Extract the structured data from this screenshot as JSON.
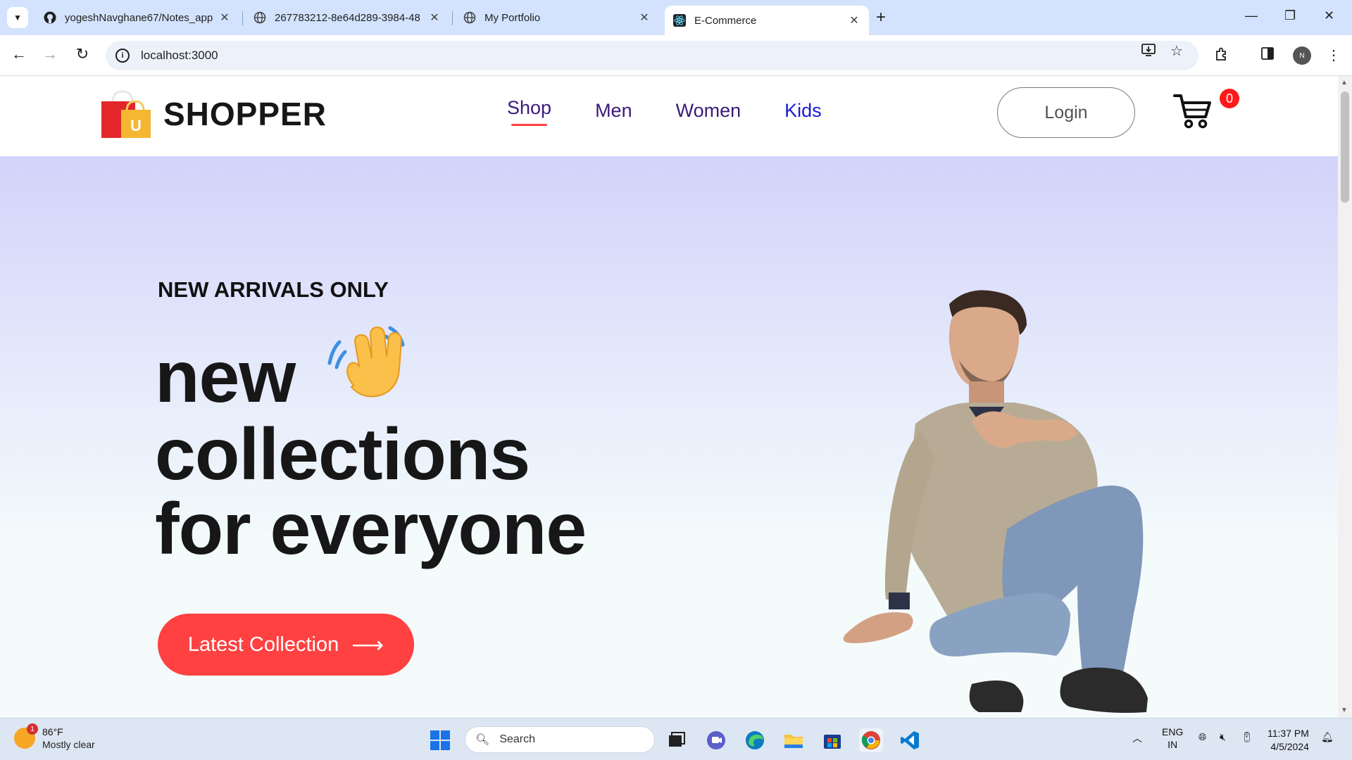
{
  "browser": {
    "tabs": [
      {
        "title": "yogeshNavghane67/Notes_app",
        "icon": "github-icon"
      },
      {
        "title": "267783212-8e64d289-3984-48",
        "icon": "globe-icon"
      },
      {
        "title": "My Portfolio",
        "icon": "globe-icon"
      },
      {
        "title": "E-Commerce",
        "icon": "react-icon",
        "active": true
      }
    ],
    "url": "localhost:3000"
  },
  "shop": {
    "brand": "SHOPPER",
    "logo_letter": "U",
    "menu": {
      "shop": "Shop",
      "men": "Men",
      "women": "Women",
      "kids": "Kids"
    },
    "login_label": "Login",
    "cart_count": "0"
  },
  "hero": {
    "kicker": "NEW ARRIVALS ONLY",
    "line1": "new",
    "line2": "collections",
    "line3": "for everyone",
    "cta_label": "Latest Collection",
    "cta_arrow": "⟶"
  },
  "taskbar": {
    "weather_temp": "86°F",
    "weather_condition": "Mostly clear",
    "weather_badge": "1",
    "search_placeholder": "Search",
    "lang_line1": "ENG",
    "lang_line2": "IN",
    "time": "11:37 PM",
    "date": "4/5/2024"
  },
  "colors": {
    "accent": "#ff4141",
    "hero_top": "#d2d3fa",
    "hero_bottom": "#f4fbfa",
    "tab_strip": "#d3e3fd"
  }
}
